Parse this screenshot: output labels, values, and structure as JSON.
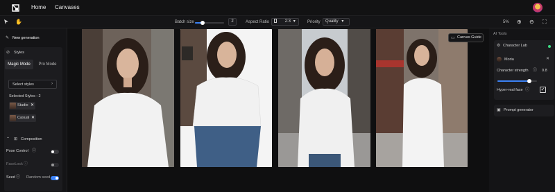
{
  "nav": {
    "home": "Home",
    "canvases": "Canvases"
  },
  "toolbar": {
    "batch_label": "Batch size",
    "batch_value": "2",
    "batch_fraction": 0.25,
    "aspect_label": "Aspect Ratio",
    "aspect_value": "2:3",
    "priority_label": "Priority",
    "priority_value": "Quality",
    "zoom": "5%"
  },
  "left_panel": {
    "new_generation": "New generation",
    "styles": {
      "title": "Styles",
      "tabs": [
        "Magic Mode",
        "Pro Mode"
      ],
      "select_label": "Select styles",
      "selected_count_label": "Selected Styles : 2",
      "chips": [
        "Studio",
        "Casual"
      ]
    },
    "composition": {
      "title": "Composition",
      "pose_control": "Pose Control",
      "face_lock": "FaceLock",
      "seed": "Seed",
      "random_seed": "Random seed"
    }
  },
  "canvas": {
    "guide_label": "Canvas Guide"
  },
  "right_panel": {
    "title": "AI Tools",
    "character_lab": "Character Lab",
    "character_name": "Moria",
    "strength_label": "Character strength",
    "strength_value": "0.8",
    "strength_fraction": 0.8,
    "hyperreal_label": "Hyper-real face",
    "hyperreal_checked": true,
    "prompt_generator": "Prompt generator"
  },
  "colors": {
    "accent": "#3c82f6",
    "status_dot": "#3ddc84"
  }
}
